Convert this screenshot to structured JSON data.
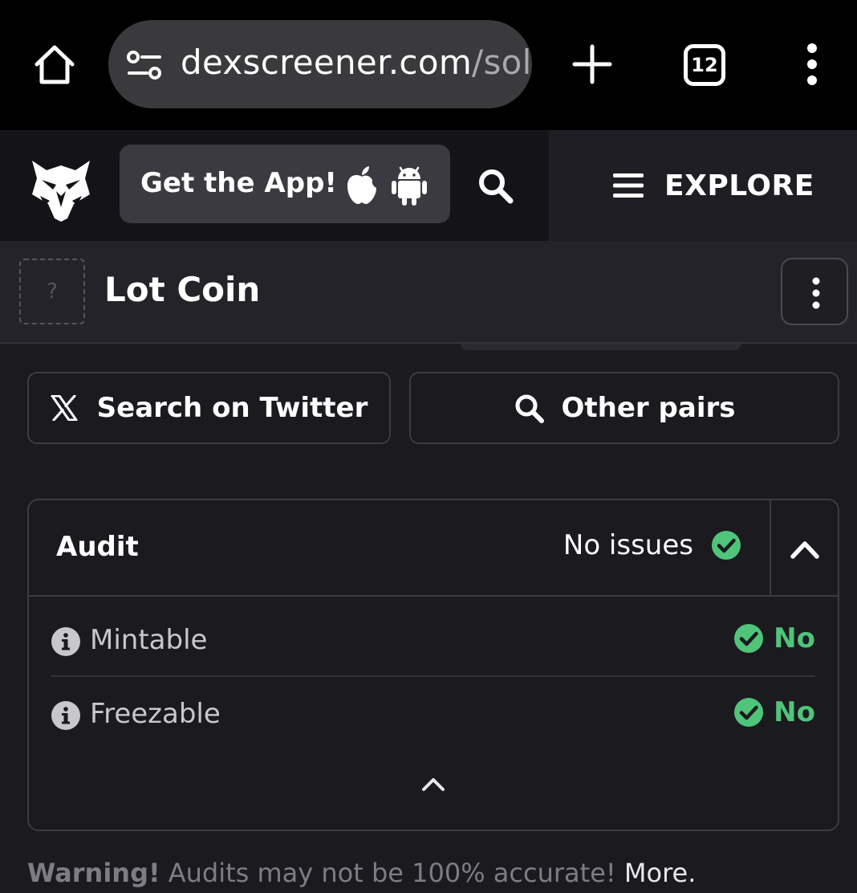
{
  "browser": {
    "url_host": "dexscreener.com",
    "url_path": "/sol",
    "tab_count": "12",
    "icons": [
      "home-icon",
      "site-settings-icon",
      "plus-icon",
      "tabs-icon",
      "kebab-menu-icon"
    ]
  },
  "header": {
    "get_app_label": "Get the App!",
    "explore_label": "EXPLORE",
    "icons": [
      "eagle-logo",
      "apple-icon",
      "android-icon",
      "search-icon",
      "hamburger-icon"
    ]
  },
  "token": {
    "placeholder_glyph": "?",
    "name": "Lot Coin"
  },
  "actions": {
    "twitter_label": "Search on Twitter",
    "other_pairs_label": "Other pairs"
  },
  "audit": {
    "title": "Audit",
    "status": "No issues",
    "rows": [
      {
        "label": "Mintable",
        "value": "No"
      },
      {
        "label": "Freezable",
        "value": "No"
      }
    ]
  },
  "warning": {
    "prefix": "Warning!",
    "text": " Audits may not be 100% accurate! ",
    "more": "More."
  },
  "colors": {
    "background": "#1a1a1f",
    "success_green": "#4fc47a",
    "chrome_black": "#000000"
  }
}
